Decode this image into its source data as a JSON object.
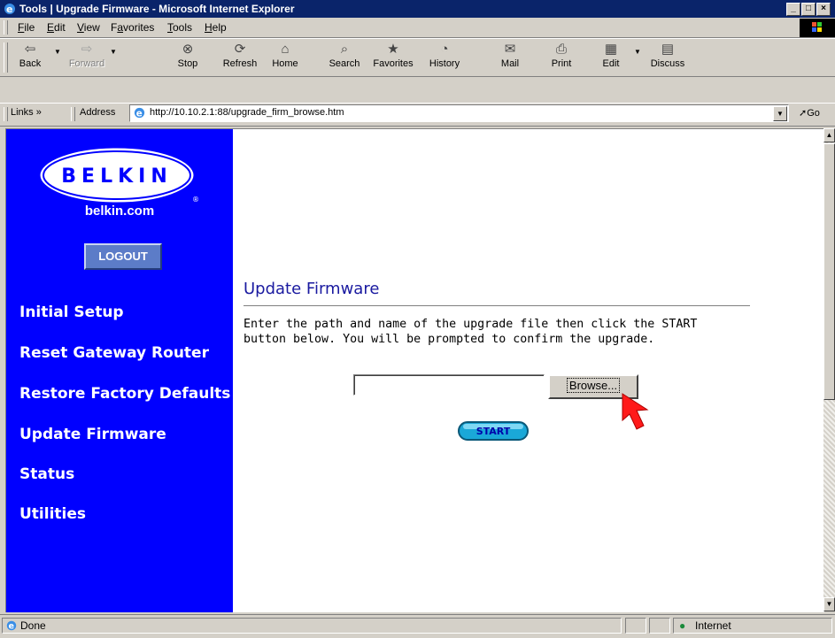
{
  "window": {
    "title": "Tools | Upgrade Firmware - Microsoft Internet Explorer",
    "controls": [
      "_",
      "□",
      "×"
    ]
  },
  "menu": [
    {
      "label": "File",
      "u": "F",
      "rest": "ile"
    },
    {
      "label": "Edit",
      "u": "E",
      "rest": "dit"
    },
    {
      "label": "View",
      "u": "V",
      "rest": "iew"
    },
    {
      "label": "Favorites",
      "u": "a",
      "pre": "F",
      "rest": "vorites"
    },
    {
      "label": "Tools",
      "u": "T",
      "rest": "ools"
    },
    {
      "label": "Help",
      "u": "H",
      "rest": "elp"
    }
  ],
  "toolbar": {
    "back": "Back",
    "forward": "Forward",
    "stop": "Stop",
    "refresh": "Refresh",
    "home": "Home",
    "search": "Search",
    "favorites": "Favorites",
    "history": "History",
    "mail": "Mail",
    "print": "Print",
    "edit": "Edit",
    "discuss": "Discuss"
  },
  "addressbar": {
    "links_label": "Links »",
    "address_label": "Address",
    "url": "http://10.10.2.1:88/upgrade_firm_browse.htm",
    "go_label": "Go"
  },
  "sidebar": {
    "logo_text": "BELKIN",
    "site": "belkin.com",
    "logout": "LOGOUT",
    "items": [
      {
        "label": "Initial Setup"
      },
      {
        "label": "Reset Gateway Router"
      },
      {
        "label": "Restore Factory Defaults"
      },
      {
        "label": "Update Firmware"
      },
      {
        "label": "Status"
      },
      {
        "label": "Utilities"
      }
    ]
  },
  "main": {
    "title": "Update Firmware",
    "description": "Enter the path and name of the upgrade file then click the START\nbutton below. You will be prompted to confirm the upgrade.",
    "file_value": "",
    "browse_label": "Browse...",
    "start_label": "START"
  },
  "statusbar": {
    "status": "Done",
    "zone": "Internet"
  },
  "colors": {
    "sidebar_bg": "#0000ff",
    "title_color": "#1a1aa0",
    "titlebar_bg": "#0a246a",
    "start_button": "#1aa8d8"
  }
}
